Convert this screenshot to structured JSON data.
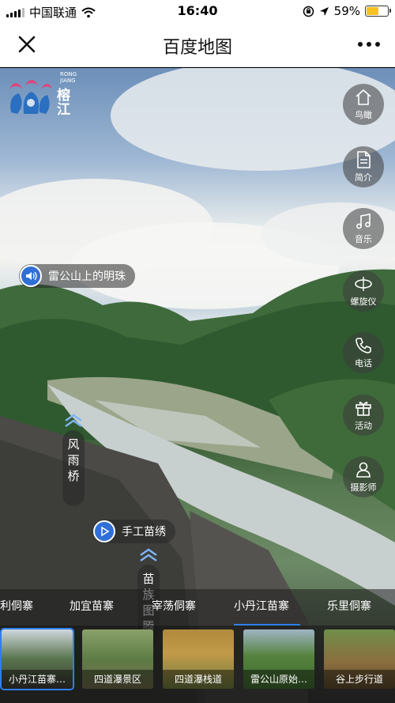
{
  "status_bar": {
    "carrier": "中国联通",
    "time": "16:40",
    "battery_percent": "59%",
    "battery_level": 0.59,
    "icons": [
      "signal-icon",
      "wifi-icon",
      "orientation-lock-icon",
      "location-icon",
      "battery-icon"
    ]
  },
  "navbar": {
    "title": "百度地图",
    "close_icon": "close-icon",
    "more_icon": "more-icon"
  },
  "logo": {
    "en_line1": "RONG",
    "en_line2": "JIANG",
    "cn": "榕江"
  },
  "side_buttons": [
    {
      "label": "鸟瞰",
      "icon": "home-icon"
    },
    {
      "label": "简介",
      "icon": "document-icon"
    },
    {
      "label": "音乐",
      "icon": "music-icon"
    },
    {
      "label": "螺旋仪",
      "icon": "gyroscope-icon"
    },
    {
      "label": "电话",
      "icon": "phone-icon"
    },
    {
      "label": "活动",
      "icon": "gift-icon"
    },
    {
      "label": "摄影师",
      "icon": "user-icon"
    }
  ],
  "hotspots": {
    "audio": "雷公山上的明珠",
    "video": "手工苗绣",
    "tag1": "风雨桥",
    "tag2": "苗族图腾"
  },
  "tabs": [
    {
      "label": "利侗寨",
      "active": false
    },
    {
      "label": "加宜苗寨",
      "active": false
    },
    {
      "label": "宰荡侗寨",
      "active": false
    },
    {
      "label": "小丹江苗寨",
      "active": true
    },
    {
      "label": "乐里侗寨",
      "active": false
    }
  ],
  "thumbnails": [
    {
      "label": "小丹江苗寨…",
      "active": true
    },
    {
      "label": "四道瀑景区",
      "active": false
    },
    {
      "label": "四道瀑栈道",
      "active": false
    },
    {
      "label": "雷公山原始…",
      "active": false
    },
    {
      "label": "谷上步行道",
      "active": false
    }
  ],
  "colors": {
    "accent": "#2f7fe8",
    "hotspot_icon": "#2f6fd6",
    "battery": "#f7c220"
  }
}
